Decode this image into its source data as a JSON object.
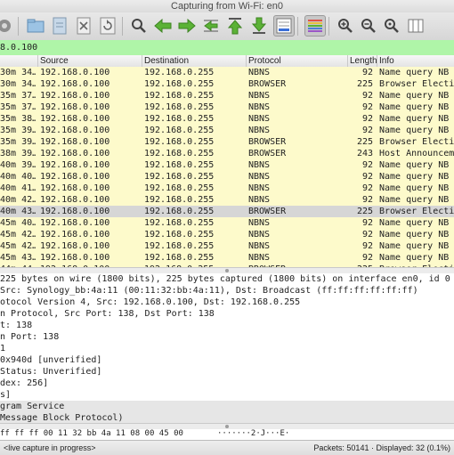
{
  "window": {
    "title": "Capturing from Wi-Fi: en0"
  },
  "toolbar": {
    "icons": [
      "options-gear-icon",
      "open-file-icon",
      "save-file-icon",
      "close-file-icon",
      "reload-icon",
      "find-packet-icon",
      "go-back-icon",
      "go-forward-icon",
      "go-to-packet-icon",
      "go-first-icon",
      "go-last-icon",
      "autoscroll-icon",
      "colorize-icon",
      "zoom-in-icon",
      "zoom-out-icon",
      "zoom-reset-icon",
      "resize-columns-icon"
    ]
  },
  "filter": {
    "value": "8.0.100",
    "color": "#aff5a8"
  },
  "packet_list": {
    "columns": [
      "Source",
      "Destination",
      "Protocol",
      "Length",
      "Info"
    ],
    "rows": [
      {
        "no": "30m 34…",
        "src": "192.168.0.100",
        "dst": "192.168.0.255",
        "proto": "NBNS",
        "len": "92",
        "info": "Name query NB N"
      },
      {
        "no": "30m 34…",
        "src": "192.168.0.100",
        "dst": "192.168.0.255",
        "proto": "BROWSER",
        "len": "225",
        "info": "Browser Electio"
      },
      {
        "no": "35m 37…",
        "src": "192.168.0.100",
        "dst": "192.168.0.255",
        "proto": "NBNS",
        "len": "92",
        "info": "Name query NB N"
      },
      {
        "no": "35m 37…",
        "src": "192.168.0.100",
        "dst": "192.168.0.255",
        "proto": "NBNS",
        "len": "92",
        "info": "Name query NB N"
      },
      {
        "no": "35m 38…",
        "src": "192.168.0.100",
        "dst": "192.168.0.255",
        "proto": "NBNS",
        "len": "92",
        "info": "Name query NB N"
      },
      {
        "no": "35m 39…",
        "src": "192.168.0.100",
        "dst": "192.168.0.255",
        "proto": "NBNS",
        "len": "92",
        "info": "Name query NB N"
      },
      {
        "no": "35m 39…",
        "src": "192.168.0.100",
        "dst": "192.168.0.255",
        "proto": "BROWSER",
        "len": "225",
        "info": "Browser Electio"
      },
      {
        "no": "38m 39…",
        "src": "192.168.0.100",
        "dst": "192.168.0.255",
        "proto": "BROWSER",
        "len": "243",
        "info": "Host Announceme"
      },
      {
        "no": "40m 39…",
        "src": "192.168.0.100",
        "dst": "192.168.0.255",
        "proto": "NBNS",
        "len": "92",
        "info": "Name query NB N"
      },
      {
        "no": "40m 40…",
        "src": "192.168.0.100",
        "dst": "192.168.0.255",
        "proto": "NBNS",
        "len": "92",
        "info": "Name query NB N"
      },
      {
        "no": "40m 41…",
        "src": "192.168.0.100",
        "dst": "192.168.0.255",
        "proto": "NBNS",
        "len": "92",
        "info": "Name query NB N"
      },
      {
        "no": "40m 42…",
        "src": "192.168.0.100",
        "dst": "192.168.0.255",
        "proto": "NBNS",
        "len": "92",
        "info": "Name query NB N"
      },
      {
        "no": "40m 43…",
        "src": "192.168.0.100",
        "dst": "192.168.0.255",
        "proto": "BROWSER",
        "len": "225",
        "info": "Browser Electio",
        "selected": true
      },
      {
        "no": "45m 40…",
        "src": "192.168.0.100",
        "dst": "192.168.0.255",
        "proto": "NBNS",
        "len": "92",
        "info": "Name query NB N"
      },
      {
        "no": "45m 42…",
        "src": "192.168.0.100",
        "dst": "192.168.0.255",
        "proto": "NBNS",
        "len": "92",
        "info": "Name query NB N"
      },
      {
        "no": "45m 42…",
        "src": "192.168.0.100",
        "dst": "192.168.0.255",
        "proto": "NBNS",
        "len": "92",
        "info": "Name query NB N"
      },
      {
        "no": "45m 43…",
        "src": "192.168.0.100",
        "dst": "192.168.0.255",
        "proto": "NBNS",
        "len": "92",
        "info": "Name query NB N"
      },
      {
        "no": "44m 44…",
        "src": "192.168.0.100",
        "dst": "192.168.0.255",
        "proto": "BROWSER",
        "len": "225",
        "info": "Browser Electio"
      }
    ],
    "row_color": "#fdfacb",
    "selected_color": "#d6d6d6"
  },
  "details": {
    "lines": [
      {
        "text": " 225 bytes on wire (1800 bits), 225 bytes captured (1800 bits) on interface en0, id 0"
      },
      {
        "text": " Src: Synology_bb:4a:11 (00:11:32:bb:4a:11), Dst: Broadcast (ff:ff:ff:ff:ff:ff)"
      },
      {
        "text": "otocol Version 4, Src: 192.168.0.100, Dst: 192.168.0.255"
      },
      {
        "text": "n Protocol, Src Port: 138, Dst Port: 138"
      },
      {
        "text": "t: 138"
      },
      {
        "text": "n Port: 138"
      },
      {
        "text": "1"
      },
      {
        "text": "0x940d [unverified]"
      },
      {
        "text": "Status: Unverified]"
      },
      {
        "text": "dex: 256]"
      },
      {
        "text": "s]"
      },
      {
        "text": "gram Service",
        "shade": true
      },
      {
        "text": "Message Block Protocol)",
        "shade": true
      }
    ]
  },
  "bytes_pane": {
    "hex": " ff ff ff 00 11  32 bb 4a 11 08 00 45 00",
    "ascii": "·······2·J···E·"
  },
  "status": {
    "capture": "<live capture in progress>",
    "counts": "Packets: 50141 · Displayed: 32 (0.1%)"
  }
}
